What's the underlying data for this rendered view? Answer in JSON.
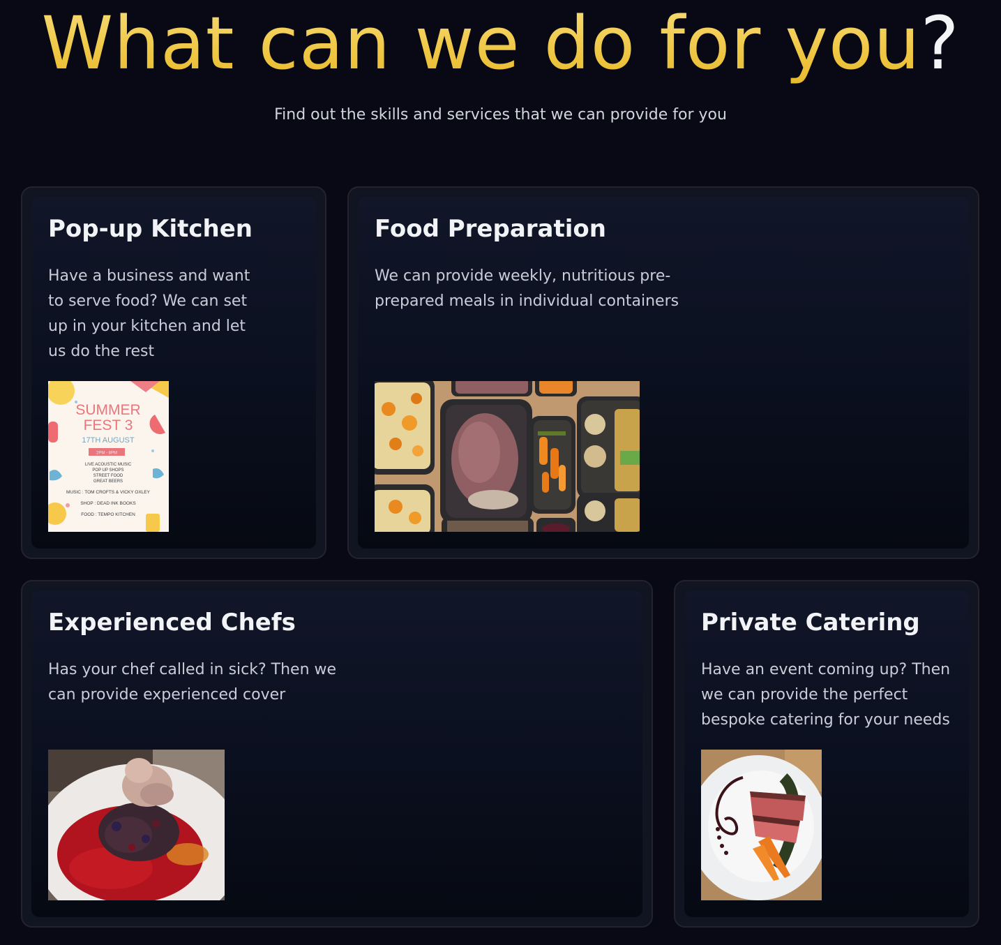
{
  "hero": {
    "title_main": "What can we do for you",
    "title_mark": "?",
    "subtitle": "Find out the skills and services that we can provide for you"
  },
  "services": [
    {
      "title": "Pop-up Kitchen",
      "description": "Have a business and want to serve food? We can set up in your kitchen and let us do the rest",
      "image": {
        "kind": "poster",
        "poster": {
          "line1": "SUMMER",
          "line2": "FEST 3",
          "date": "17TH AUGUST",
          "time": "2PM - 8PM",
          "items": [
            "LIVE ACOUSTIC MUSIC",
            "POP UP SHOPS",
            "STREET FOOD",
            "GREAT BEERS"
          ],
          "music": "MUSIC : TOM CROFTS & VICKY OXLEY",
          "shop": "SHOP : DEAD INK BOOKS",
          "food": "FOOD : TEMPO KITCHEN"
        }
      }
    },
    {
      "title": "Food Preparation",
      "description": "We can provide weekly, nutritious pre-prepared meals in individual containers",
      "image": {
        "kind": "meal-prep-containers-photo"
      }
    },
    {
      "title": "Experienced Chefs",
      "description": "Has your chef called in sick? Then we can provide experienced cover",
      "image": {
        "kind": "dessert-plate-photo"
      }
    },
    {
      "title": "Private Catering",
      "description": "Have an event coming up? Then we can provide the perfect bespoke catering for your needs",
      "image": {
        "kind": "plated-steak-photo"
      }
    }
  ],
  "colors": {
    "background": "#080914",
    "title_gold": "#efc744",
    "card_border": "#24232d",
    "card_text": "#c9cdd8"
  }
}
